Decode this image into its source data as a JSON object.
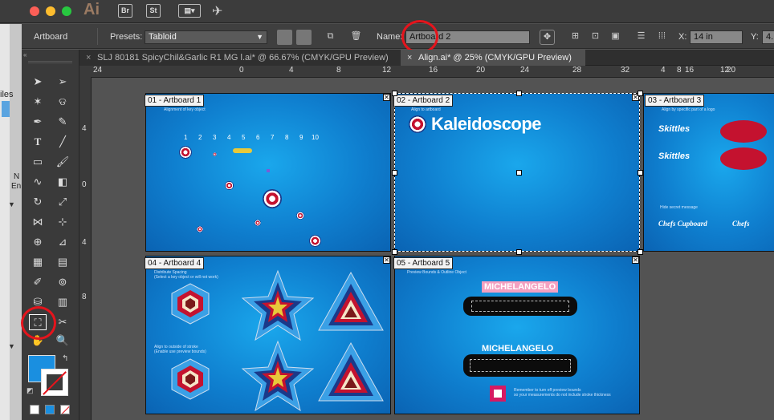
{
  "menubar": {
    "app_logo": "Ai",
    "bridge_label": "Br",
    "stock_label": "St"
  },
  "control": {
    "tool_name": "Artboard",
    "presets_label": "Presets:",
    "preset_value": "Tabloid",
    "name_label": "Name:",
    "name_value": "Artboard 2",
    "x_label": "X:",
    "x_value": "14 in",
    "y_label": "Y:",
    "y_value": "4."
  },
  "left_panel_fragments": [
    "iles",
    "N",
    "En"
  ],
  "tabs": [
    {
      "label": "SLJ 80181 SpicyChil&Garlic R1 MG l.ai* @ 66.67% (CMYK/GPU Preview)",
      "active": false
    },
    {
      "label": "Align.ai* @ 25% (CMYK/GPU Preview)",
      "active": true
    }
  ],
  "hruler": [
    "24",
    "0",
    "4",
    "8",
    "12",
    "16",
    "20",
    "24",
    "28",
    "32",
    "4",
    "8",
    "12",
    "16",
    "20"
  ],
  "vruler": [
    "4",
    "0",
    "4",
    "8"
  ],
  "artboards": {
    "ab1": {
      "label": "01 - Artboard 1",
      "caption": "Alignment of key object",
      "numbers": [
        "1",
        "2",
        "3",
        "4",
        "5",
        "6",
        "7",
        "8",
        "9",
        "10"
      ]
    },
    "ab2": {
      "label": "02 - Artboard 2",
      "caption": "Align to artboard",
      "logo": "Kaleidoscope"
    },
    "ab3": {
      "label": "03 - Artboard 3",
      "caption": "Align by specific part of a logo",
      "brand1": "Skittles",
      "brand2": "Skittles",
      "caption2": "Hide secret message",
      "brand3": "Chefs Cupboard",
      "brand4": "Chefs"
    },
    "ab4": {
      "label": "04 - Artboard 4",
      "caption1": "Distribute Spacing",
      "caption1b": "(Select a key object or will not work)",
      "caption2": "Align to outside of stroke",
      "caption2b": "(Enable use preview bounds)"
    },
    "ab5": {
      "label": "05 - Artboard 5",
      "caption": "Preview Bounds & Outline Object",
      "word1": "MICHELANGELO",
      "word2": "MICHELANGELO",
      "note1": "Remember to turn off preview bounds",
      "note2": "so your measurements do not include stroke thickness"
    }
  },
  "colors": {
    "highlight_ring": "#e5141c",
    "artboard_blue": "#1195e0",
    "fill_swatch": "#1a8fe0"
  }
}
